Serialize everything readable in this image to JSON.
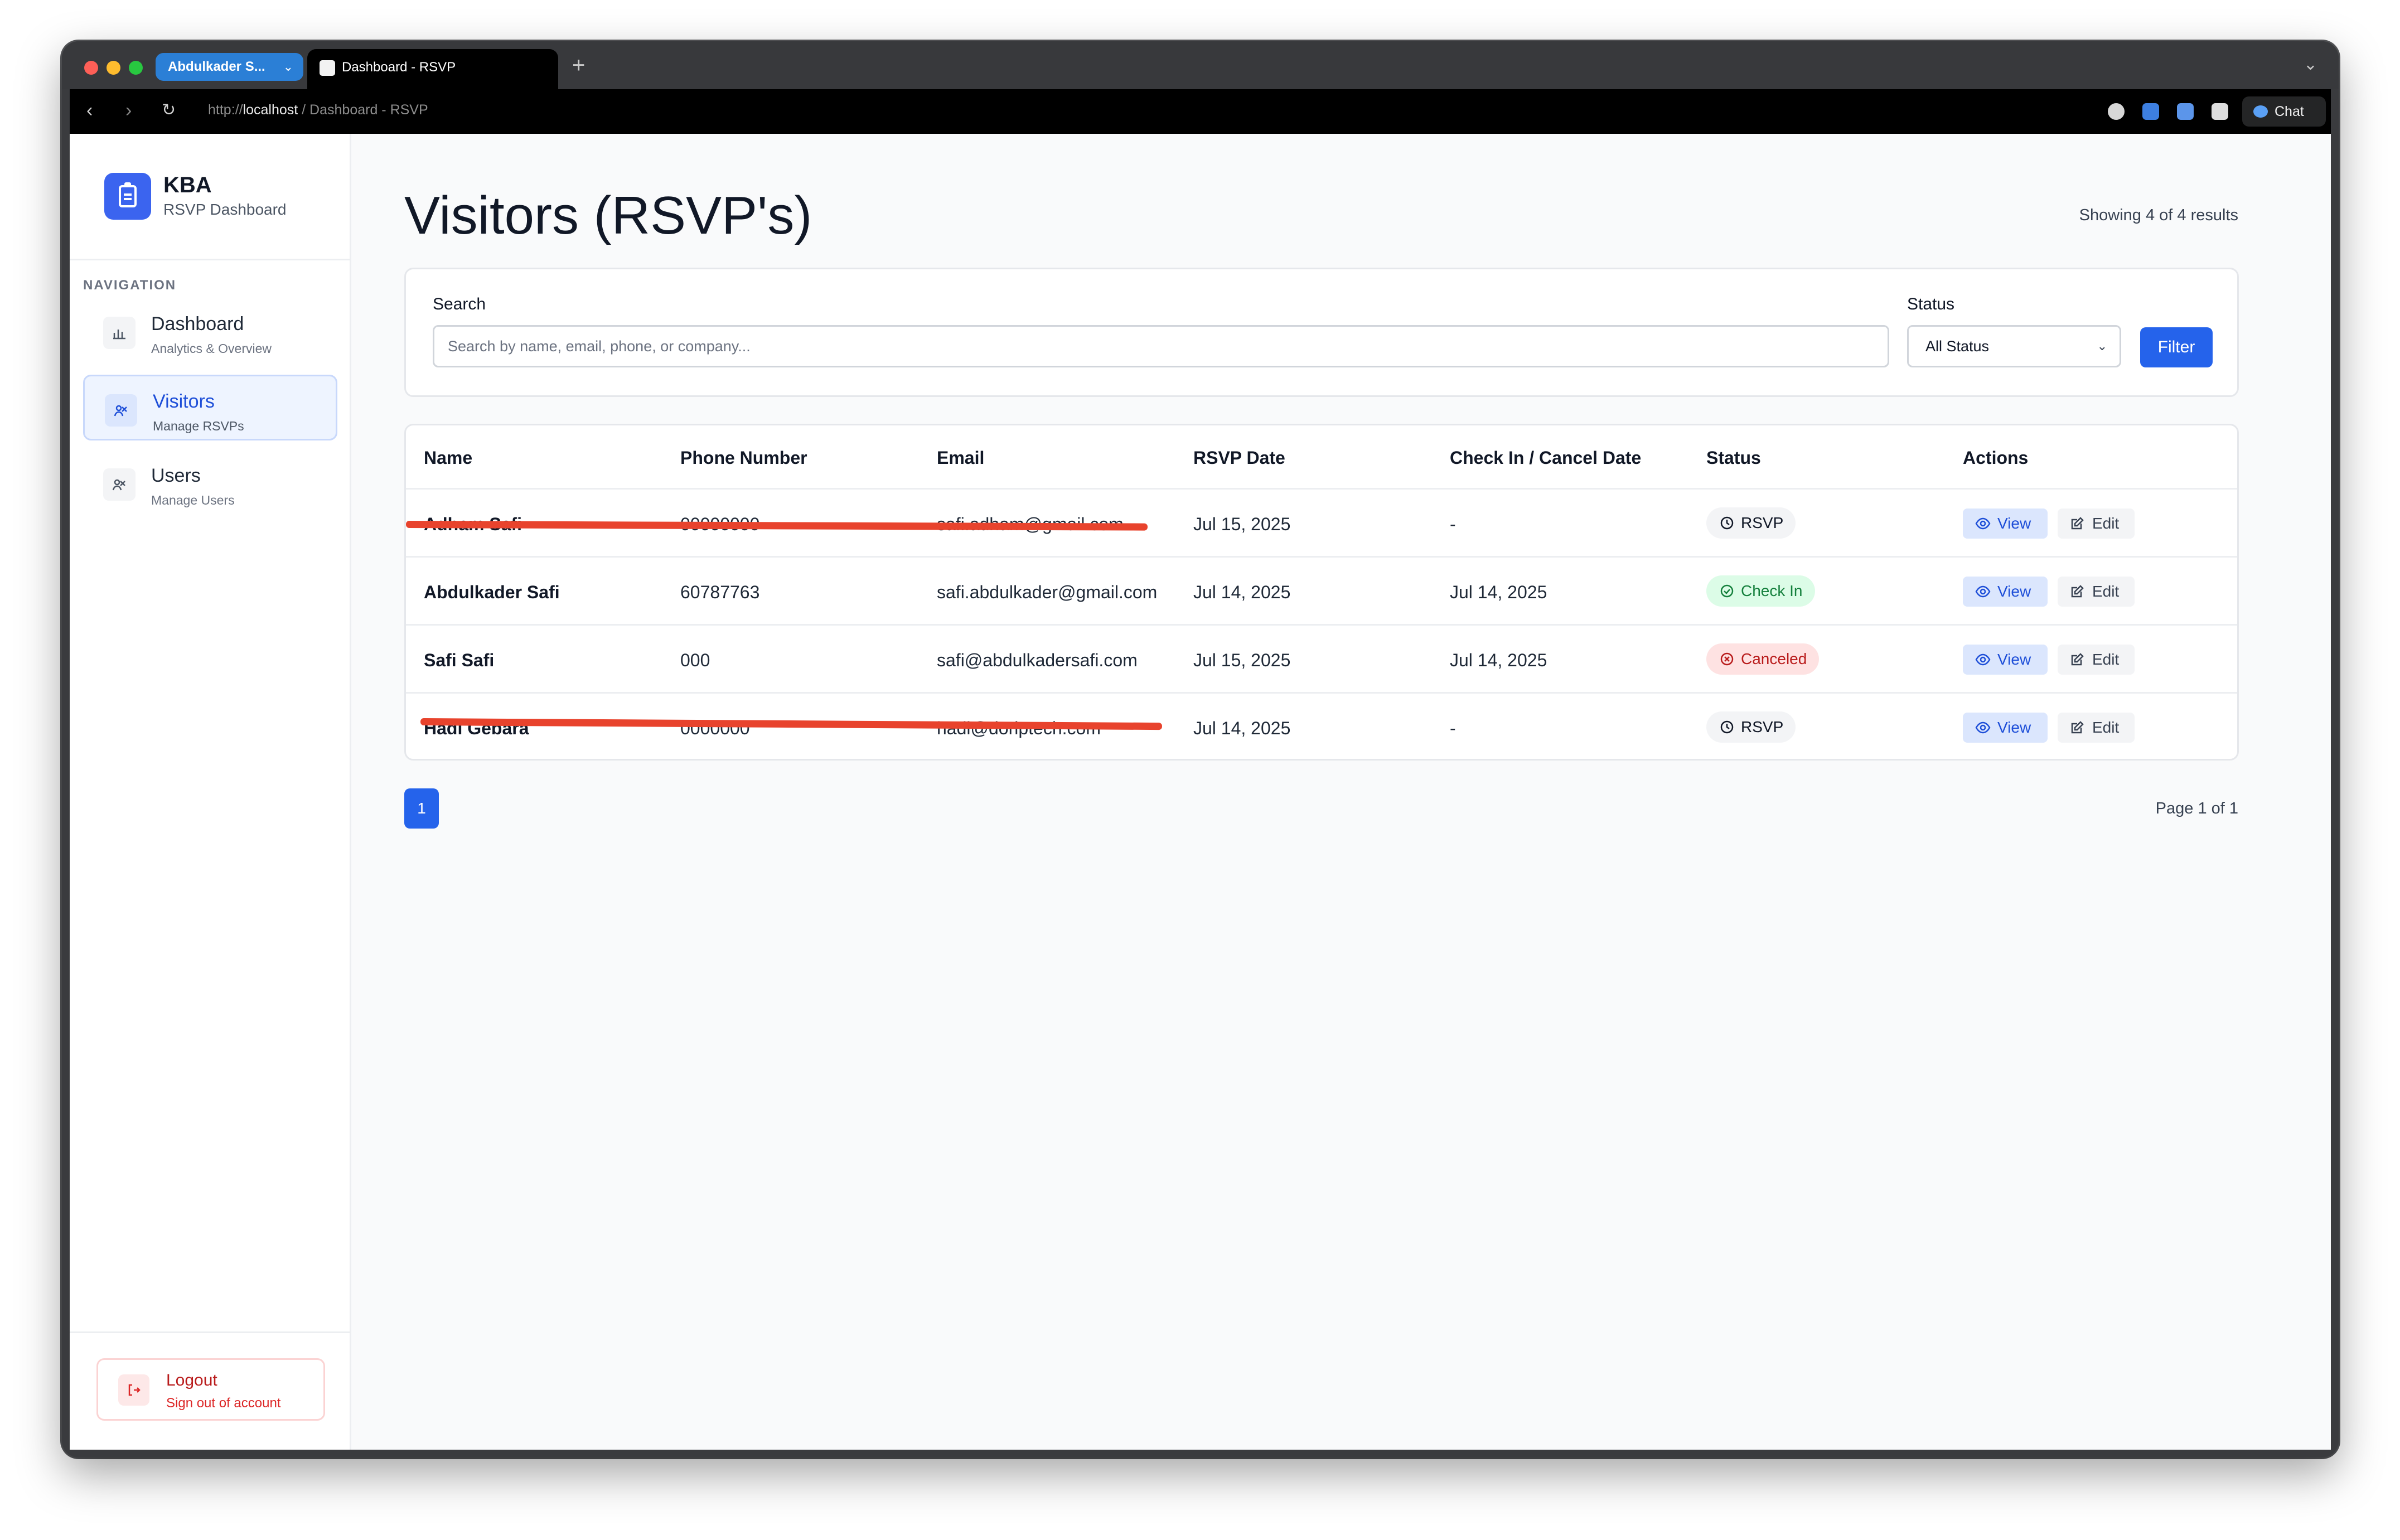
{
  "browser": {
    "profile_tab": "Abdulkader S...",
    "active_tab": "Dashboard - RSVP",
    "new_tab": "+",
    "url_scheme": "http://",
    "url_host": "localhost",
    "url_path": " / Dashboard - RSVP",
    "chat_label": "Chat"
  },
  "sidebar": {
    "brand_name": "KBA",
    "brand_sub": "RSVP Dashboard",
    "nav_heading": "NAVIGATION",
    "items": [
      {
        "title": "Dashboard",
        "sub": "Analytics & Overview"
      },
      {
        "title": "Visitors",
        "sub": "Manage RSVPs"
      },
      {
        "title": "Users",
        "sub": "Manage Users"
      }
    ],
    "logout_title": "Logout",
    "logout_sub": "Sign out of account"
  },
  "main": {
    "title": "Visitors (RSVP's)",
    "results": "Showing 4 of 4 results",
    "search_label": "Search",
    "search_placeholder": "Search by name, email, phone, or company...",
    "status_label": "Status",
    "status_value": "All Status",
    "filter_label": "Filter",
    "columns": [
      "Name",
      "Phone Number",
      "Email",
      "RSVP Date",
      "Check In / Cancel Date",
      "Status",
      "Actions"
    ],
    "rows": [
      {
        "name": "Adham Safi",
        "phone": "00000000",
        "email": "safi.adham@gmail.com",
        "rsvp_date": "Jul 15, 2025",
        "check_date": "-",
        "status": "RSVP"
      },
      {
        "name": "Abdulkader Safi",
        "phone": "60787763",
        "email": "safi.abdulkader@gmail.com",
        "rsvp_date": "Jul 14, 2025",
        "check_date": "Jul 14, 2025",
        "status": "Check In"
      },
      {
        "name": "Safi Safi",
        "phone": "000",
        "email": "safi@abdulkadersafi.com",
        "rsvp_date": "Jul 15, 2025",
        "check_date": "Jul 14, 2025",
        "status": "Canceled"
      },
      {
        "name": "Hadi Gebara",
        "phone": "0000000",
        "email": "hadi@doriptech.com",
        "rsvp_date": "Jul 14, 2025",
        "check_date": "-",
        "status": "RSVP"
      }
    ],
    "view_label": "View",
    "edit_label": "Edit",
    "page_number": "1",
    "page_info": "Page 1 of 1"
  },
  "colors": {
    "accent": "#2563eb",
    "check_in": "#15803d",
    "canceled": "#b91c1c",
    "redaction": "#e8432d"
  }
}
